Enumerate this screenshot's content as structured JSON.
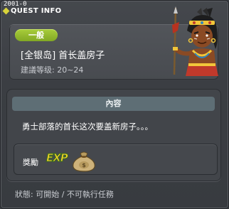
{
  "window": {
    "quest_id": "2001-0",
    "title": "QUEST INFO"
  },
  "quest": {
    "category_badge": "一般",
    "name": "[全银岛] 首长盖房子",
    "level_text": "建議等级: 20~24",
    "npc": "tribal-chief-npc"
  },
  "content": {
    "header": "內容",
    "description": "勇士部落的首长这次要盖新房子。。。"
  },
  "reward": {
    "label": "獎勵",
    "exp_text": "EXP",
    "item": "money-bag-icon"
  },
  "status": {
    "text": "狀態: 可開始 / 不可執行任務"
  },
  "colors": {
    "badge_green": "#9bc233",
    "title_icon_yellow": "#d8d33a",
    "content_header_bg": "#5e6e75"
  }
}
